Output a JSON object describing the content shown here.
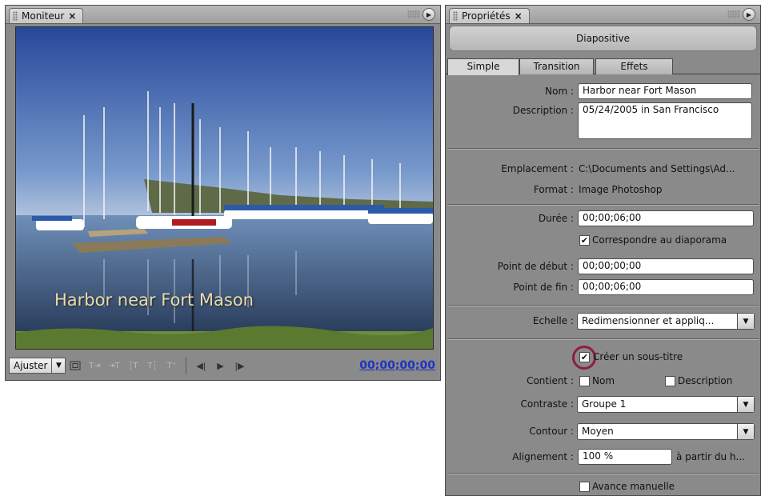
{
  "monitor": {
    "tab_label": "Moniteur",
    "close_glyph": "×",
    "menu_glyph": "▶",
    "caption": "Harbor near Fort Mason",
    "fit_label": "Ajuster",
    "dropdown_glyph": "▼",
    "timecode": "00;00;00;00",
    "tools": [
      "safe-margins-icon",
      "add-text-icon",
      "add-text-right-icon",
      "trim-in-icon",
      "trim-out-icon",
      "add-marker-icon"
    ],
    "transport": {
      "prev_glyph": "◀|",
      "play_glyph": "▶",
      "next_glyph": "|▶"
    }
  },
  "properties": {
    "tab_label": "Propriétés",
    "close_glyph": "×",
    "menu_glyph": "▶",
    "header": "Diapositive",
    "tabs": [
      "Simple",
      "Transition",
      "Effets"
    ],
    "active_tab": "Simple",
    "nom": {
      "label": "Nom :",
      "value": "Harbor near Fort Mason"
    },
    "description": {
      "label": "Description :",
      "value": "05/24/2005 in San Francisco"
    },
    "emplacement": {
      "label": "Emplacement :",
      "value": "C:\\Documents and Settings\\Ad..."
    },
    "format": {
      "label": "Format :",
      "value": "Image Photoshop"
    },
    "duree": {
      "label": "Durée :",
      "value": "00;00;06;00"
    },
    "match_slideshow": {
      "label": "Correspondre au diaporama",
      "checked": true
    },
    "point_debut": {
      "label": "Point de début :",
      "value": "00;00;00;00"
    },
    "point_fin": {
      "label": "Point de fin :",
      "value": "00;00;06;00"
    },
    "echelle": {
      "label": "Echelle :",
      "value": "Redimensionner et appliq..."
    },
    "sous_titre": {
      "label": "Créer un sous-titre",
      "checked": true
    },
    "contient": {
      "label": "Contient :",
      "opt1": "Nom",
      "opt2": "Description"
    },
    "contraste": {
      "label": "Contraste :",
      "value": "Groupe 1"
    },
    "contour": {
      "label": "Contour :",
      "value": "Moyen"
    },
    "alignement": {
      "label": "Alignement :",
      "value": "100 %",
      "suffix": "à partir du h..."
    },
    "avance": {
      "label": "Avance manuelle",
      "checked": false
    },
    "check_glyph": "✔"
  },
  "colors": {
    "panel": "#8a8a8a",
    "timecode": "#1d35c0",
    "highlight": "#8a1f45"
  }
}
